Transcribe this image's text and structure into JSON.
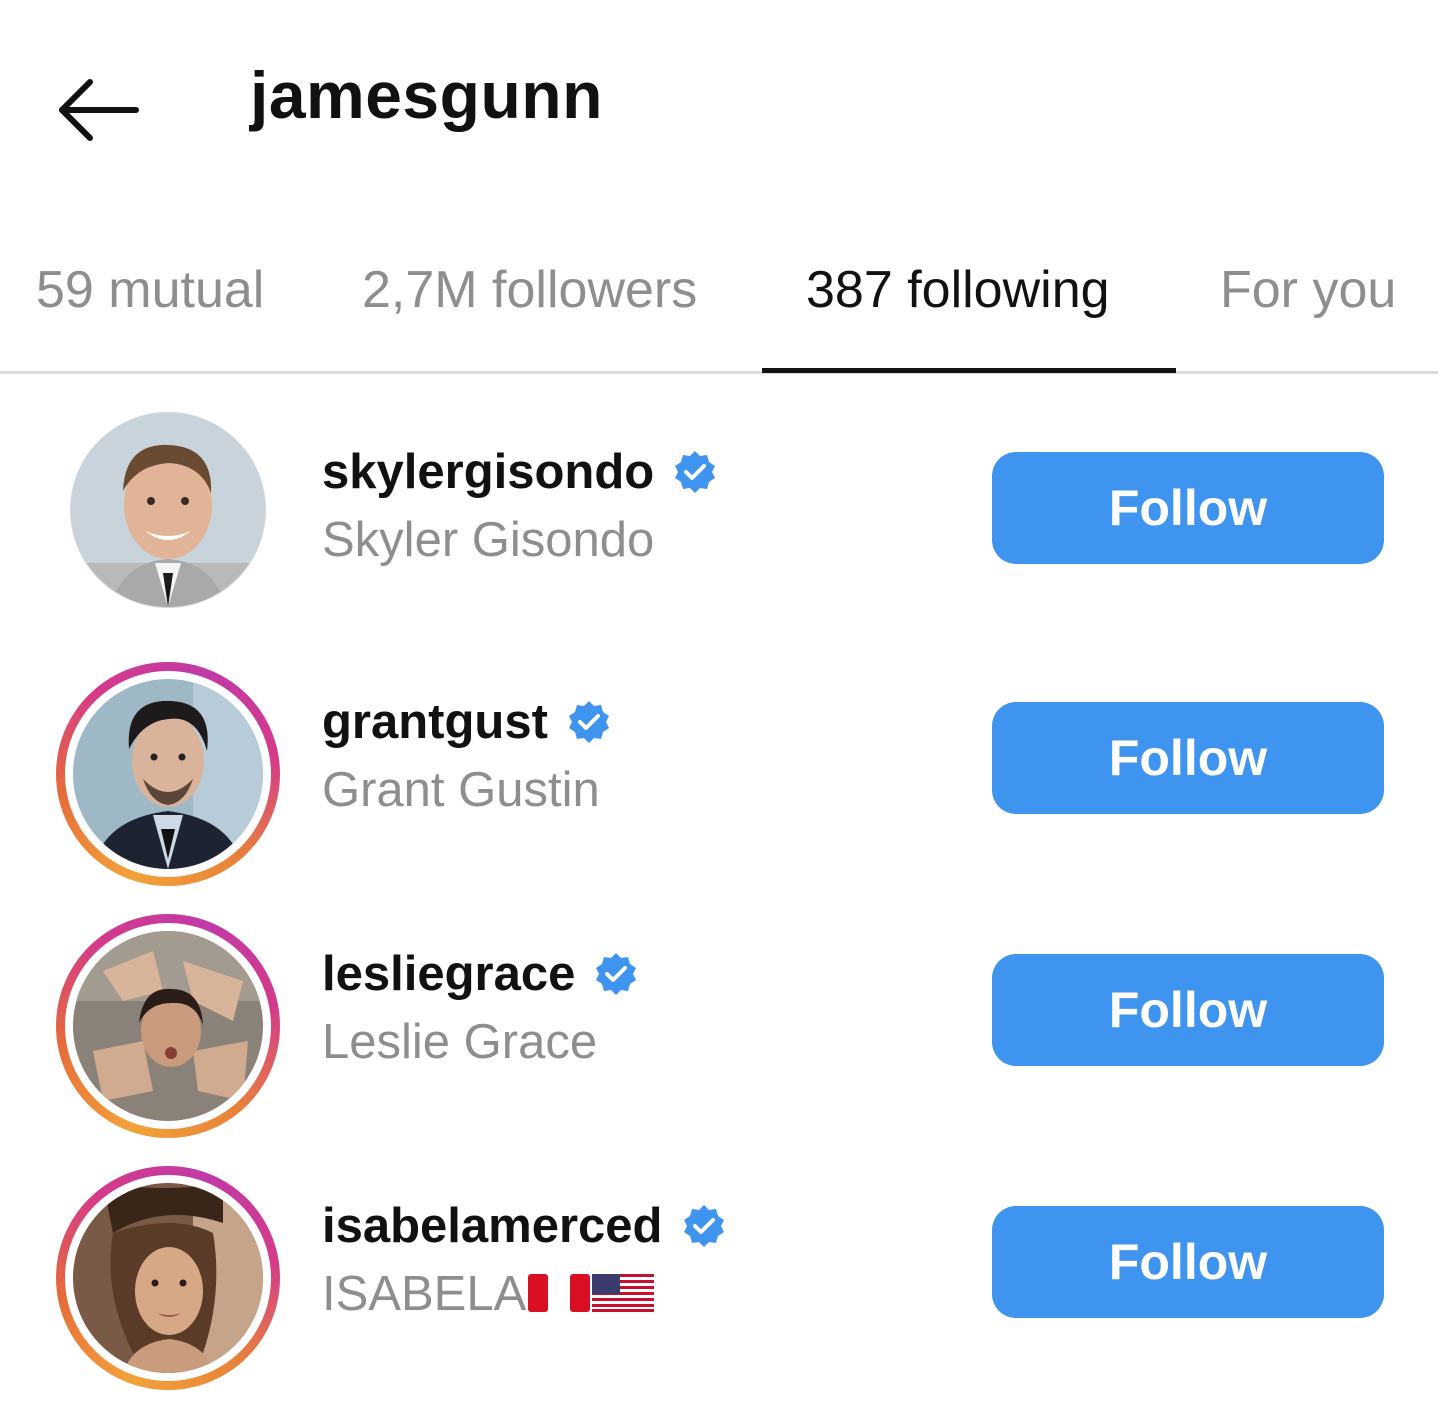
{
  "header": {
    "back_icon": "arrow-left-icon",
    "title": "jamesgunn"
  },
  "tabs": [
    {
      "label": "59 mutual",
      "active": false
    },
    {
      "label": "2,7M followers",
      "active": false
    },
    {
      "label": "387 following",
      "active": true
    },
    {
      "label": "For you",
      "active": false
    }
  ],
  "colors": {
    "follow_button": "#3e94ee",
    "verified_badge": "#3e94ee",
    "secondary_text": "#8e8e8e",
    "story_ring_start": "#f3a23a",
    "story_ring_end": "#c13aa8"
  },
  "users": [
    {
      "username": "skylergisondo",
      "full_name": "Skyler Gisondo",
      "verified": true,
      "story_ring": false,
      "follow_label": "Follow"
    },
    {
      "username": "grantgust",
      "full_name": "Grant Gustin",
      "verified": true,
      "story_ring": true,
      "follow_label": "Follow"
    },
    {
      "username": "lesliegrace",
      "full_name": "Leslie Grace",
      "verified": true,
      "story_ring": true,
      "follow_label": "Follow"
    },
    {
      "username": "isabelamerced",
      "full_name": "ISABELA",
      "full_name_emoji": [
        "peru-flag-emoji",
        "us-flag-emoji"
      ],
      "verified": true,
      "story_ring": true,
      "follow_label": "Follow"
    }
  ]
}
